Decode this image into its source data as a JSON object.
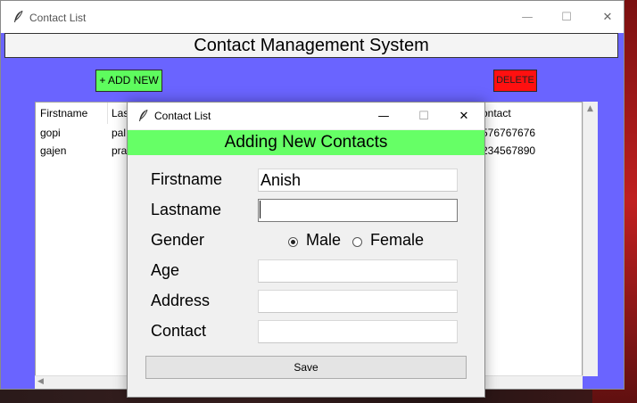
{
  "main_window": {
    "title": "Contact List",
    "controls": {
      "minimize": "—",
      "maximize": "☐",
      "close": "✕"
    },
    "header": "Contact Management System",
    "add_button": "+ ADD NEW",
    "delete_button": "DELETE",
    "table": {
      "columns": [
        "Firstname",
        "Last",
        "ontact"
      ],
      "rows": [
        {
          "firstname": "gopi",
          "lastname": "pal",
          "contact": "576767676"
        },
        {
          "firstname": "gajen",
          "lastname": "pra",
          "contact": "234567890"
        }
      ]
    }
  },
  "dialog": {
    "title": "Contact List",
    "controls": {
      "minimize": "—",
      "maximize": "☐",
      "close": "✕"
    },
    "banner": "Adding New Contacts",
    "labels": {
      "firstname": "Firstname",
      "lastname": "Lastname",
      "gender": "Gender",
      "age": "Age",
      "address": "Address",
      "contact": "Contact"
    },
    "values": {
      "firstname": "Anish",
      "lastname": "",
      "age": "",
      "address": "",
      "contact": ""
    },
    "gender_options": {
      "male": "Male",
      "female": "Female",
      "selected": "Male"
    },
    "save_button": "Save"
  },
  "colors": {
    "window_bg": "#6a64ff",
    "add_button": "#5efc5e",
    "delete_button": "#ff1010",
    "banner": "#66ff66"
  },
  "icons": {
    "app_icon": "feather-icon"
  }
}
